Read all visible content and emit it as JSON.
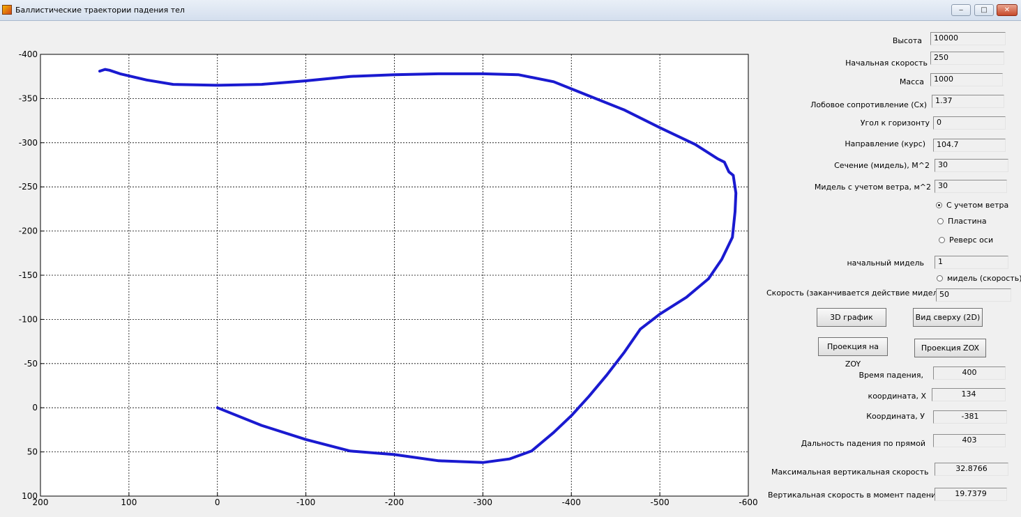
{
  "window": {
    "title": "Баллистические траектории падения тел",
    "min": "‒",
    "max": "□",
    "close": "✕"
  },
  "chart_data": {
    "type": "line",
    "title": "",
    "xlabel": "",
    "ylabel": "",
    "xlim": [
      200,
      -600
    ],
    "ylim": [
      -400,
      100
    ],
    "xticks": [
      200,
      100,
      0,
      -100,
      -200,
      -300,
      -400,
      -500,
      -600
    ],
    "xtick_labels": [
      "200",
      "100",
      "0",
      "-100",
      "-200",
      "-300",
      "-400",
      "-500",
      "-600"
    ],
    "yticks": [
      -400,
      -350,
      -300,
      -250,
      -200,
      -150,
      -100,
      -50,
      0,
      50,
      100
    ],
    "ytick_labels": [
      "-400",
      "-350",
      "-300",
      "-250",
      "-200",
      "-150",
      "-100",
      "-50",
      "0",
      "50",
      "100"
    ],
    "grid": true,
    "line_color": "#1a1ad0",
    "series": [
      {
        "x": [
          0,
          -50,
          -100,
          -150,
          -200,
          -250,
          -300,
          -330,
          -355,
          -380,
          -400,
          -420,
          -440,
          -460,
          -478,
          -500,
          -530,
          -555,
          -570,
          -582,
          -585,
          -586,
          -583,
          -578,
          -573,
          -565,
          -540,
          -500,
          -460,
          -420,
          -380,
          -340,
          -300,
          -250,
          -200,
          -150,
          -100,
          -50,
          0,
          50,
          80,
          110,
          122,
          127,
          133
        ],
        "y": [
          0,
          20,
          36,
          49,
          53,
          60,
          62,
          58,
          49,
          28,
          9,
          -13,
          -37,
          -63,
          -89,
          -106,
          -125,
          -146,
          -168,
          -193,
          -222,
          -243,
          -263,
          -267,
          -278,
          -282,
          -298,
          -317,
          -337,
          -353,
          -369,
          -377,
          -378,
          -378,
          -377,
          -375,
          -370,
          -366,
          -365,
          -366,
          -371,
          -378,
          -382,
          -383,
          -381
        ]
      }
    ]
  },
  "params": {
    "height_label": "Высота",
    "height_value": "10000",
    "speed_label": "Начальная скорость",
    "speed_value": "250",
    "mass_label": "Масса",
    "mass_value": "1000",
    "drag_label": "Лобовое сопротивление (Cx)",
    "drag_value": "1.37",
    "angle_label": "Угол к горизонту",
    "angle_value": "0",
    "course_label": "Направление  (курс)",
    "course_value": "104.7",
    "section_label": "Сечение (мидель), М^2",
    "section_value": "30",
    "wind_section_label": "Мидель с учетом ветра, м^2",
    "wind_section_value": "30"
  },
  "radios": {
    "wind": "С учетом ветра",
    "plate": "Пластина",
    "reverse": "Реверс оси",
    "midel_speed": "мидель (скорость)"
  },
  "initial_midel": {
    "label": "начальный мидель",
    "value": "1"
  },
  "speed_end": {
    "label": "Скорость (заканчивается действие миделя)",
    "value": "50"
  },
  "buttons": {
    "plot3d": "3D график",
    "top_view": "Вид сверху (2D)",
    "proj_zoy": "Проекция на ZOY",
    "proj_zox": "Проекция ZOX"
  },
  "results": {
    "time_label": "Время падения,",
    "time_value": "400",
    "x_label": "координата, Х",
    "x_value": "134",
    "y_label": "Координата, У",
    "y_value": "-381",
    "range_label": "Дальность падения по прямой",
    "range_value": "403",
    "max_vert_label": "Максимальная вертикальная скорость",
    "max_vert_value": "32.8766",
    "impact_vert_label": "Вертикальная  скорость в момент падения",
    "impact_vert_value": "19.7379"
  }
}
